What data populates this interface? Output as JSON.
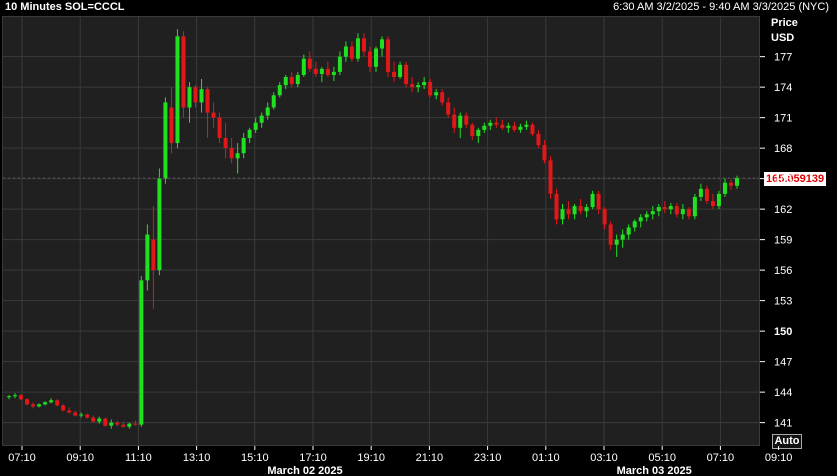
{
  "header": {
    "title": "10 Minutes SOL=CCCL",
    "range": "6:30 AM 3/2/2025 - 9:40 AM 3/3/2025 (NYC)"
  },
  "axis": {
    "price_label": "Price",
    "currency": "USD",
    "auto_label": "Auto"
  },
  "last_price_label": "165.059139",
  "colors": {
    "background": "#000000",
    "plot_background": "#202020",
    "grid": "#3a3a3a",
    "up": "#20e020",
    "down": "#e01818",
    "last_price_text": "#e00000"
  },
  "chart_data": {
    "type": "candlestick",
    "title": "10 Minutes SOL=CCCL",
    "y_ticks": [
      141,
      144,
      147,
      150,
      153,
      156,
      159,
      162,
      165,
      168,
      171,
      174,
      177
    ],
    "ylim": [
      138.8,
      180.9
    ],
    "y_grid": true,
    "x_ticks": [
      "07:10",
      "09:10",
      "11:10",
      "13:10",
      "15:10",
      "17:10",
      "19:10",
      "21:10",
      "23:10",
      "01:10",
      "03:10",
      "05:10",
      "07:10",
      "09:10"
    ],
    "x_date_labels": [
      {
        "label": "March 02 2025",
        "after_tick": 5
      },
      {
        "label": "March 03 2025",
        "after_tick": 11
      }
    ],
    "last_price": 165.059139,
    "series_summary": [
      {
        "period": "06:30-10:50 Mar 2",
        "range": [
          140.4,
          143.9
        ]
      },
      {
        "period": "10:50-11:20 Mar 2",
        "range": [
          140.8,
          179.7
        ]
      },
      {
        "period": "11:20-18:00 Mar 2",
        "range": [
          165.5,
          179.5
        ]
      },
      {
        "period": "18:00-01:00 Mar 3",
        "range": [
          168.8,
          179.3
        ]
      },
      {
        "period": "01:00-04:30 Mar 3",
        "range": [
          157.3,
          169.5
        ]
      },
      {
        "period": "04:30-09:40 Mar 3",
        "range": [
          158.5,
          165.3
        ]
      }
    ],
    "candles": [
      [
        143.5,
        143.7,
        143.3,
        143.6
      ],
      [
        143.6,
        143.9,
        143.4,
        143.7
      ],
      [
        143.7,
        143.8,
        143.2,
        143.3
      ],
      [
        143.3,
        143.4,
        142.7,
        142.8
      ],
      [
        142.8,
        143.0,
        142.4,
        142.6
      ],
      [
        142.6,
        142.9,
        142.5,
        142.8
      ],
      [
        142.8,
        143.1,
        142.7,
        143.0
      ],
      [
        143.0,
        143.4,
        142.9,
        143.2
      ],
      [
        143.2,
        143.3,
        142.6,
        142.7
      ],
      [
        142.7,
        142.8,
        142.1,
        142.2
      ],
      [
        142.2,
        142.5,
        141.9,
        142.0
      ],
      [
        142.0,
        142.2,
        141.6,
        141.7
      ],
      [
        141.7,
        142.0,
        141.5,
        141.8
      ],
      [
        141.8,
        141.9,
        141.4,
        141.5
      ],
      [
        141.5,
        141.7,
        141.0,
        141.1
      ],
      [
        141.1,
        141.6,
        140.9,
        141.4
      ],
      [
        141.4,
        141.5,
        140.6,
        140.7
      ],
      [
        140.7,
        141.3,
        140.4,
        141.0
      ],
      [
        141.0,
        141.2,
        140.6,
        140.8
      ],
      [
        140.8,
        141.1,
        140.5,
        140.6
      ],
      [
        140.6,
        141.0,
        140.4,
        140.9
      ],
      [
        140.9,
        141.2,
        140.7,
        140.8
      ],
      [
        140.8,
        155.4,
        140.6,
        155.0
      ],
      [
        155.0,
        160.5,
        154.0,
        159.5
      ],
      [
        159.0,
        162.3,
        152.2,
        156.0
      ],
      [
        156.0,
        166.0,
        155.5,
        165.0
      ],
      [
        165.0,
        173.0,
        164.5,
        172.5
      ],
      [
        172.0,
        174.0,
        167.5,
        168.5
      ],
      [
        168.5,
        179.7,
        168.0,
        179.0
      ],
      [
        179.0,
        179.5,
        171.0,
        172.0
      ],
      [
        172.0,
        174.5,
        170.5,
        174.0
      ],
      [
        174.0,
        174.2,
        172.0,
        172.5
      ],
      [
        172.5,
        174.8,
        171.5,
        173.8
      ],
      [
        173.8,
        174.0,
        169.0,
        171.5
      ],
      [
        171.5,
        172.5,
        170.0,
        171.0
      ],
      [
        171.0,
        171.5,
        168.5,
        169.0
      ],
      [
        169.0,
        170.5,
        167.0,
        168.0
      ],
      [
        168.0,
        169.0,
        166.5,
        167.0
      ],
      [
        167.0,
        168.5,
        165.5,
        167.5
      ],
      [
        167.5,
        169.5,
        167.0,
        169.0
      ],
      [
        169.0,
        170.0,
        168.5,
        169.8
      ],
      [
        169.8,
        171.0,
        169.5,
        170.5
      ],
      [
        170.5,
        171.5,
        170.0,
        171.2
      ],
      [
        171.2,
        172.5,
        170.8,
        172.0
      ],
      [
        172.0,
        173.5,
        171.8,
        173.2
      ],
      [
        173.2,
        174.5,
        173.0,
        174.2
      ],
      [
        174.2,
        175.2,
        173.8,
        175.0
      ],
      [
        175.0,
        175.5,
        174.0,
        174.3
      ],
      [
        174.3,
        175.5,
        174.0,
        175.2
      ],
      [
        175.2,
        177.2,
        175.0,
        176.8
      ],
      [
        176.8,
        177.5,
        175.5,
        175.8
      ],
      [
        175.8,
        176.5,
        175.0,
        175.3
      ],
      [
        175.3,
        176.0,
        174.5,
        175.8
      ],
      [
        175.8,
        176.5,
        175.0,
        175.2
      ],
      [
        175.2,
        176.0,
        174.6,
        175.5
      ],
      [
        175.5,
        177.5,
        175.2,
        177.0
      ],
      [
        177.0,
        178.5,
        176.5,
        178.0
      ],
      [
        178.0,
        178.5,
        176.5,
        176.8
      ],
      [
        176.8,
        179.3,
        176.5,
        178.8
      ],
      [
        178.8,
        179.3,
        177.0,
        177.5
      ],
      [
        177.5,
        178.0,
        175.5,
        176.0
      ],
      [
        176.0,
        178.0,
        175.5,
        177.8
      ],
      [
        177.8,
        179.0,
        177.0,
        178.7
      ],
      [
        178.7,
        179.0,
        175.0,
        175.5
      ],
      [
        175.5,
        176.5,
        174.5,
        175.0
      ],
      [
        175.0,
        176.5,
        174.8,
        176.2
      ],
      [
        176.2,
        176.5,
        174.0,
        174.3
      ],
      [
        174.3,
        175.0,
        173.5,
        174.0
      ],
      [
        174.0,
        174.5,
        173.5,
        174.2
      ],
      [
        174.2,
        175.0,
        173.8,
        174.5
      ],
      [
        174.5,
        174.8,
        173.0,
        173.2
      ],
      [
        173.2,
        173.8,
        172.8,
        173.5
      ],
      [
        173.5,
        173.8,
        172.2,
        172.5
      ],
      [
        172.5,
        173.0,
        171.0,
        171.3
      ],
      [
        171.3,
        172.0,
        169.5,
        170.0
      ],
      [
        170.0,
        171.5,
        169.0,
        171.2
      ],
      [
        171.2,
        171.5,
        170.0,
        170.3
      ],
      [
        170.3,
        170.5,
        168.8,
        169.2
      ],
      [
        169.2,
        170.0,
        168.5,
        169.8
      ],
      [
        169.8,
        170.5,
        169.5,
        170.2
      ],
      [
        170.2,
        170.8,
        169.8,
        170.5
      ],
      [
        170.5,
        171.0,
        170.0,
        170.3
      ],
      [
        170.3,
        170.8,
        169.8,
        170.0
      ],
      [
        170.0,
        170.5,
        169.5,
        170.2
      ],
      [
        170.2,
        170.6,
        169.6,
        169.8
      ],
      [
        169.8,
        170.4,
        169.5,
        170.1
      ],
      [
        170.1,
        170.7,
        169.8,
        170.3
      ],
      [
        170.3,
        170.5,
        169.2,
        169.4
      ],
      [
        169.4,
        169.8,
        168.0,
        168.3
      ],
      [
        168.3,
        168.8,
        166.5,
        166.8
      ],
      [
        166.8,
        167.2,
        163.0,
        163.5
      ],
      [
        163.5,
        164.0,
        160.5,
        161.0
      ],
      [
        161.0,
        162.5,
        160.5,
        162.0
      ],
      [
        162.0,
        162.8,
        161.0,
        161.5
      ],
      [
        161.5,
        162.5,
        161.0,
        162.3
      ],
      [
        162.3,
        163.0,
        161.5,
        161.8
      ],
      [
        161.8,
        162.5,
        161.2,
        162.2
      ],
      [
        162.2,
        163.8,
        162.0,
        163.5
      ],
      [
        163.5,
        163.8,
        161.5,
        162.0
      ],
      [
        162.0,
        162.2,
        160.0,
        160.5
      ],
      [
        160.5,
        160.8,
        158.0,
        158.5
      ],
      [
        158.5,
        159.5,
        157.3,
        159.0
      ],
      [
        159.0,
        160.0,
        158.2,
        159.5
      ],
      [
        159.5,
        160.5,
        159.0,
        160.2
      ],
      [
        160.2,
        161.0,
        159.8,
        160.8
      ],
      [
        160.8,
        161.5,
        160.2,
        161.2
      ],
      [
        161.2,
        161.8,
        160.8,
        161.5
      ],
      [
        161.5,
        162.3,
        161.0,
        161.8
      ],
      [
        161.8,
        162.5,
        161.3,
        162.2
      ],
      [
        162.2,
        162.8,
        161.6,
        162.0
      ],
      [
        162.0,
        162.6,
        161.5,
        162.3
      ],
      [
        162.3,
        162.6,
        161.2,
        161.5
      ],
      [
        161.5,
        162.5,
        161.0,
        162.0
      ],
      [
        162.0,
        162.2,
        161.0,
        161.3
      ],
      [
        161.3,
        163.5,
        161.0,
        163.2
      ],
      [
        163.2,
        164.5,
        162.8,
        164.0
      ],
      [
        164.0,
        164.3,
        162.5,
        162.8
      ],
      [
        162.8,
        163.5,
        162.0,
        162.3
      ],
      [
        162.3,
        163.8,
        162.0,
        163.5
      ],
      [
        163.5,
        165.0,
        163.2,
        164.6
      ],
      [
        164.6,
        164.9,
        163.9,
        164.3
      ],
      [
        164.3,
        165.3,
        164.0,
        165.06
      ]
    ]
  }
}
